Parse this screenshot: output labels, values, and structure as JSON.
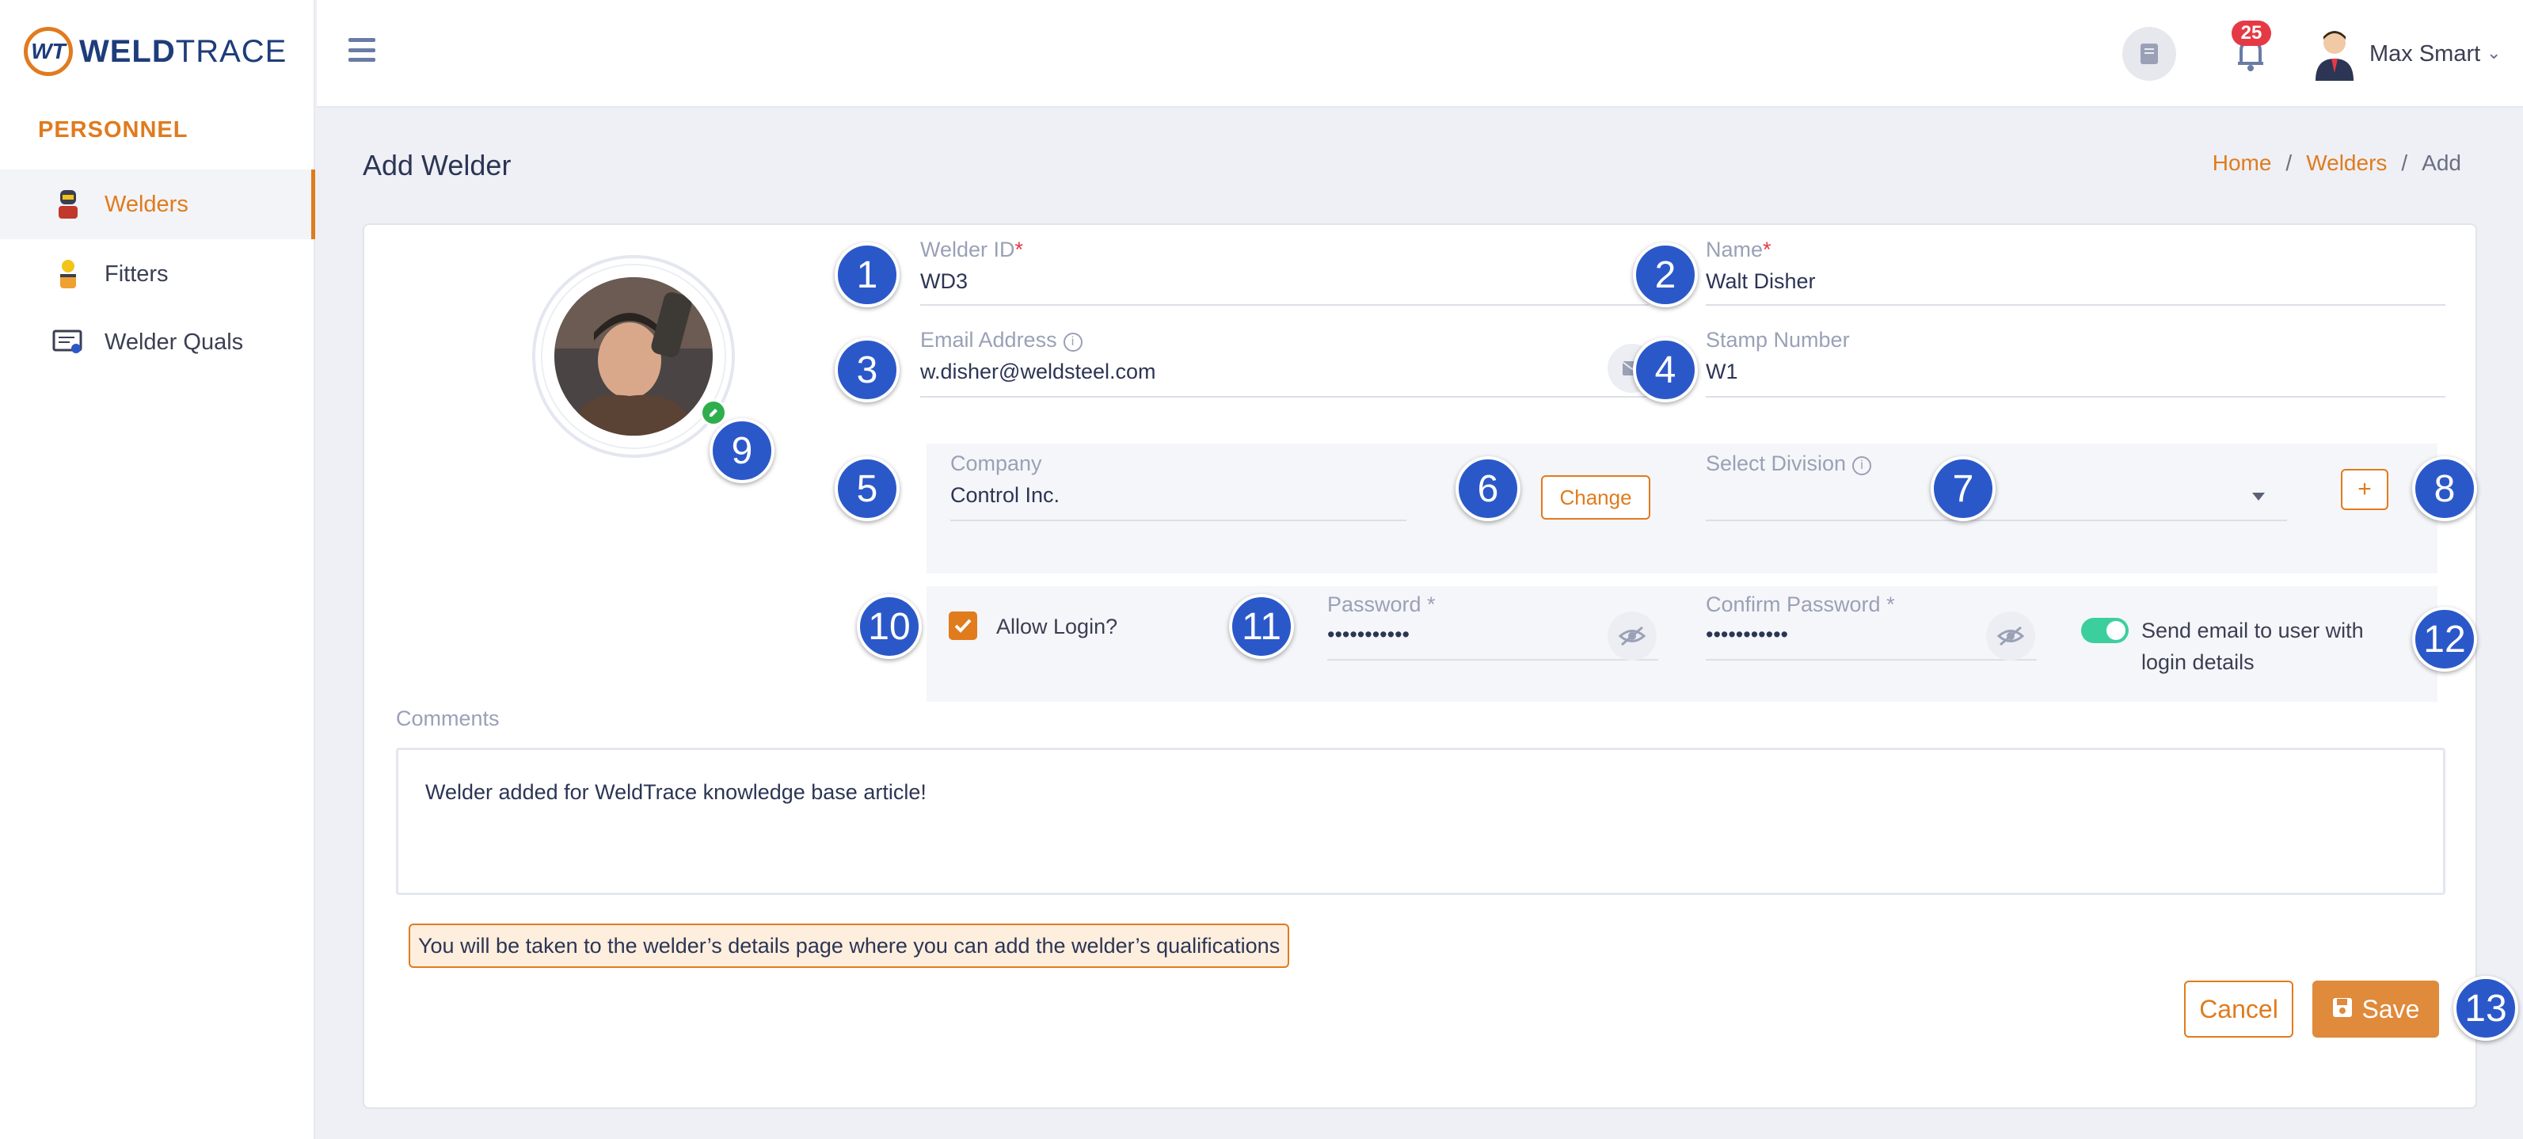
{
  "app": {
    "brand_w": "WELD",
    "brand_t": "TRACE",
    "logo_mark": "WT"
  },
  "sidebar": {
    "section": "PERSONNEL",
    "items": [
      {
        "label": "Welders",
        "icon": "welder-icon",
        "active": true
      },
      {
        "label": "Fitters",
        "icon": "fitter-icon",
        "active": false
      },
      {
        "label": "Welder Quals",
        "icon": "certificate-icon",
        "active": false
      }
    ]
  },
  "topbar": {
    "notifications_count": "25",
    "user_name": "Max Smart"
  },
  "page": {
    "title": "Add Welder",
    "breadcrumb": [
      "Home",
      "Welders",
      "Add"
    ]
  },
  "form": {
    "welder_id": {
      "label": "Welder ID",
      "value": "WD3"
    },
    "name": {
      "label": "Name",
      "value": "Walt Disher"
    },
    "email": {
      "label": "Email Address",
      "value": "w.disher@weldsteel.com"
    },
    "stamp": {
      "label": "Stamp Number",
      "value": "W1"
    },
    "company": {
      "label": "Company",
      "value": "Control Inc.",
      "change_label": "Change"
    },
    "division": {
      "label": "Select Division",
      "value": ""
    },
    "allow_login": {
      "label": "Allow Login?",
      "checked": true
    },
    "password": {
      "label": "Password *",
      "value": "•••••••••••"
    },
    "confirm_password": {
      "label": "Confirm Password *",
      "value": "•••••••••••"
    },
    "send_email": {
      "label": "Send email to user with login details",
      "on": true
    },
    "comments": {
      "label": "Comments",
      "value": "Welder added for WeldTrace knowledge base article!"
    },
    "note": "You will be taken to the welder’s details page where you can add the welder’s qualifications",
    "cancel_label": "Cancel",
    "save_label": "Save"
  },
  "markers": [
    "1",
    "2",
    "3",
    "4",
    "5",
    "6",
    "7",
    "8",
    "9",
    "10",
    "11",
    "12",
    "13"
  ],
  "colors": {
    "accent": "#e07b1e",
    "marker": "#2b58c9",
    "toggle_on": "#3ccf9e",
    "badge": "#e63946"
  }
}
